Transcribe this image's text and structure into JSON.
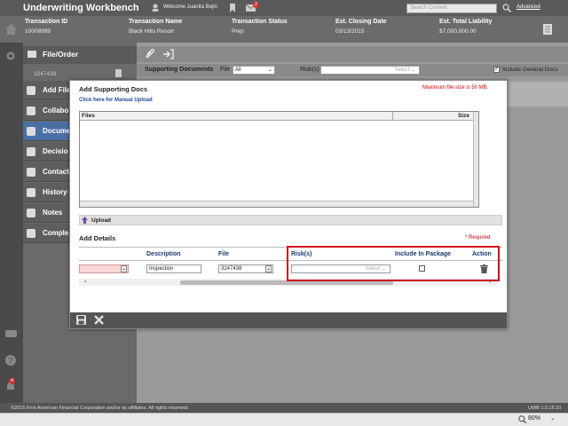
{
  "app": {
    "title": "Underwriting Workbench",
    "welcome": "Welcome Juanita Bejin",
    "notification_count": "2",
    "search_placeholder": "Search Content",
    "advanced_link": "Advanced"
  },
  "transaction": {
    "id_label": "Transaction ID",
    "id_value": "10008999",
    "name_label": "Transaction Name",
    "name_value": "Black Hills Resort",
    "status_label": "Transaction Status",
    "status_value": "Prep",
    "closing_label": "Est. Closing Date",
    "closing_value": "03/13/2015",
    "liability_label": "Est. Total Liability",
    "liability_value": "$7,000,000.00"
  },
  "sidenav": {
    "header": "File/Order",
    "order_number": "3247438",
    "items": [
      {
        "label": "Add File"
      },
      {
        "label": "Collabo"
      },
      {
        "label": "Docume"
      },
      {
        "label": "Decisio"
      },
      {
        "label": "Contact"
      },
      {
        "label": "History"
      },
      {
        "label": "Notes"
      },
      {
        "label": "Comple"
      }
    ]
  },
  "supporting_bar": {
    "label": "Supporting Documents",
    "file_label": "File",
    "file_value": "All",
    "risk_label": "Risk(s)",
    "risk_select": "Select",
    "include_general": "Include General Docs"
  },
  "modal": {
    "title": "Add Supporting Docs",
    "max_size": "Maximum file size is 50 MB.",
    "manual_upload": "Click here for Manual Upload",
    "files_col": "Files",
    "size_col": "Size",
    "upload_label": "Upload",
    "add_details": "Add Details",
    "required": "* Required",
    "columns": {
      "description": "Description",
      "file": "File",
      "risks": "Risk(s)",
      "include": "Include In Package",
      "action": "Action"
    },
    "row": {
      "description": "Inspection",
      "file": "3247438",
      "risk_select": "Select"
    }
  },
  "footer": {
    "copyright": "©2015 First American Financial Corporation and/or its affiliates. All rights reserved.",
    "version": "UWB 1.0.15.10",
    "zoom": "80%"
  },
  "colors": {
    "accent": "#4a6fa5",
    "highlight": "#d0101a",
    "required": "#c00000"
  }
}
